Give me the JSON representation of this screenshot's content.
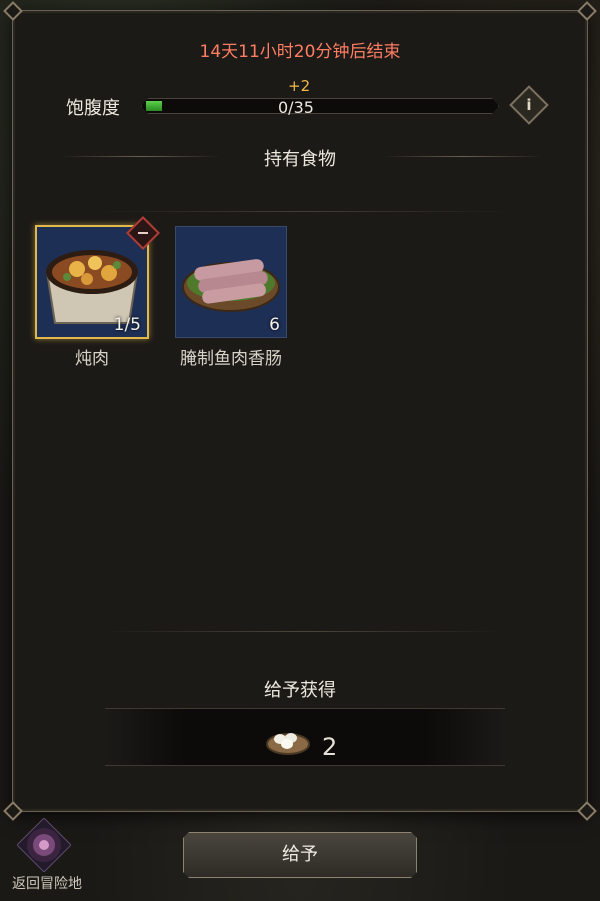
{
  "event": {
    "timer_text": "14天11小时20分钟后结束"
  },
  "satiety": {
    "label": "饱腹度",
    "gain": "+2",
    "value_text": "0/35",
    "progress": 0.0
  },
  "food_section": {
    "title": "持有食物",
    "items": [
      {
        "name": "炖肉",
        "count": "1/5",
        "selected": true
      },
      {
        "name": "腌制鱼肉香肠",
        "count": "6",
        "selected": false
      }
    ]
  },
  "reward": {
    "title": "给予获得",
    "count": "2",
    "icon": "egg-nest-icon"
  },
  "actions": {
    "give_label": "给予"
  },
  "nav": {
    "return_label": "返回冒险地"
  },
  "colors": {
    "timer": "#ff7d63",
    "gain": "#f2b94a",
    "bar_fill": "#5cd14a",
    "slot_bg": "#1e2f56",
    "selected_border": "#e0b84c"
  }
}
